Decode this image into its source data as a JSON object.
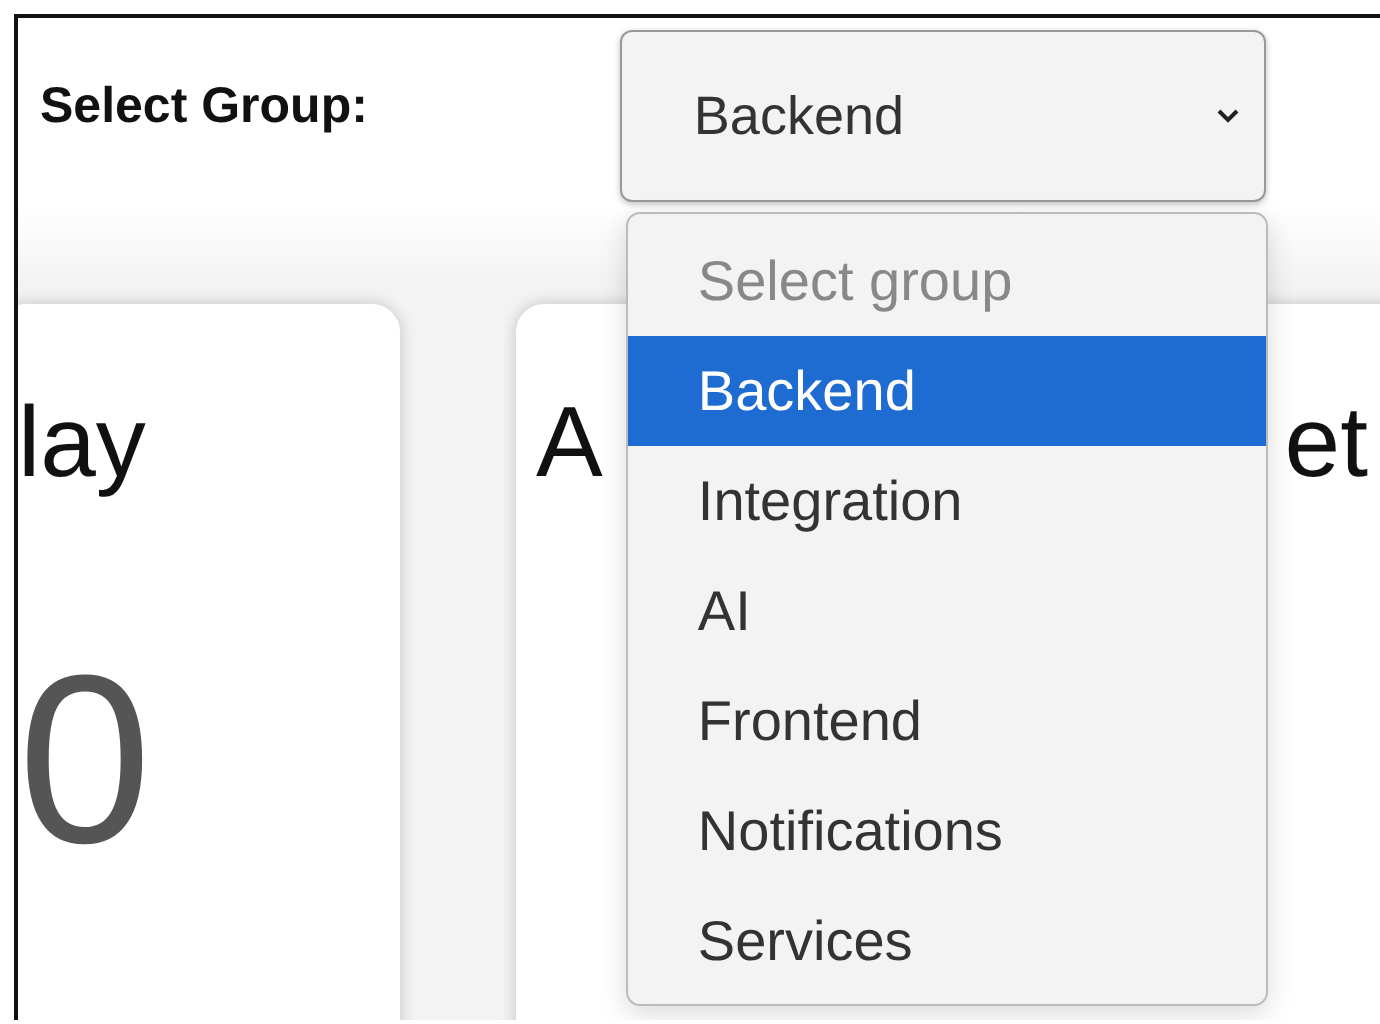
{
  "group_filter": {
    "label": "Select Group:",
    "value": "Backend",
    "expanded": true,
    "options": [
      {
        "label": "Select group",
        "kind": "placeholder",
        "selected": false
      },
      {
        "label": "Backend",
        "kind": "option",
        "selected": true
      },
      {
        "label": "Integration",
        "kind": "option",
        "selected": false
      },
      {
        "label": "AI",
        "kind": "option",
        "selected": false
      },
      {
        "label": "Frontend",
        "kind": "option",
        "selected": false
      },
      {
        "label": "Notifications",
        "kind": "option",
        "selected": false
      },
      {
        "label": "Services",
        "kind": "option",
        "selected": false
      }
    ]
  },
  "cards": [
    {
      "title_parts": [
        "lay"
      ],
      "value": "0"
    },
    {
      "title_parts": [
        "A",
        "et"
      ]
    }
  ]
}
